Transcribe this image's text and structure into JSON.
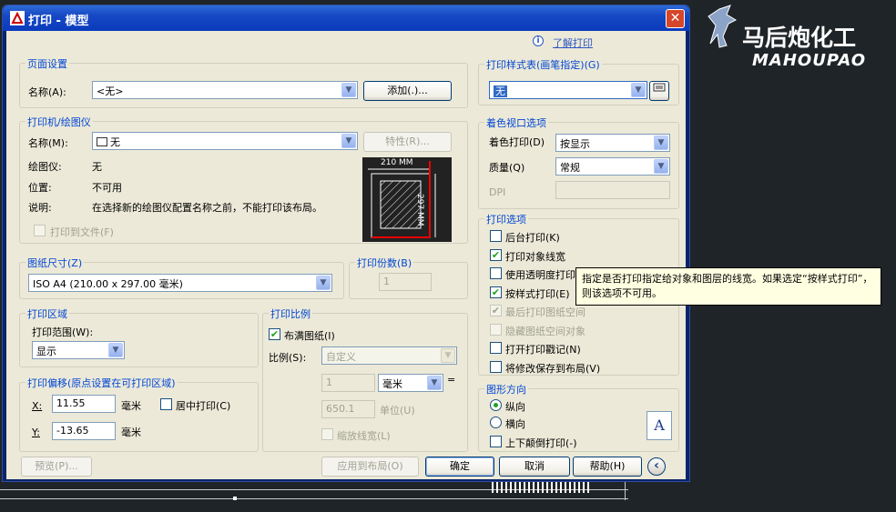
{
  "window": {
    "title": "打印 - 模型",
    "close_glyph": "✕"
  },
  "help": {
    "icon": "i",
    "link": "了解打印"
  },
  "page_setup": {
    "group": "页面设置",
    "name_label": "名称(A):",
    "name_value": "<无>",
    "add_button": "添加(.)..."
  },
  "printer": {
    "group": "打印机/绘图仪",
    "name_label": "名称(M):",
    "name_value": "无",
    "properties_button": "特性(R)...",
    "plotter_label": "绘图仪:",
    "plotter_value": "无",
    "location_label": "位置:",
    "location_value": "不可用",
    "desc_label": "说明:",
    "desc_value": "在选择新的绘图仪配置名称之前，不能打印该布局。",
    "print_to_file": "打印到文件(F)",
    "preview_width": "210 MM",
    "preview_height": "297 MM"
  },
  "paper": {
    "group": "图纸尺寸(Z)",
    "value": "ISO A4 (210.00 x 297.00 毫米)"
  },
  "copies": {
    "group": "打印份数(B)",
    "value": "1"
  },
  "area": {
    "group": "打印区域",
    "range_label": "打印范围(W):",
    "range_value": "显示"
  },
  "offset": {
    "group": "打印偏移(原点设置在可打印区域)",
    "x_label": "X:",
    "x_value": "11.55",
    "y_label": "Y:",
    "y_value": "-13.65",
    "unit": "毫米",
    "center": "居中打印(C)"
  },
  "scale": {
    "group": "打印比例",
    "fit": "布满图纸(I)",
    "scale_label": "比例(S):",
    "scale_value": "自定义",
    "v1": "1",
    "unit1": "毫米",
    "eq": "=",
    "v2": "650.1",
    "unit2": "单位(U)",
    "lineweights": "缩放线宽(L)"
  },
  "style_table": {
    "group": "打印样式表(画笔指定)(G)",
    "value": "无"
  },
  "shaded": {
    "group": "着色视口选项",
    "shade_label": "着色打印(D)",
    "shade_value": "按显示",
    "quality_label": "质量(Q)",
    "quality_value": "常规",
    "dpi_label": "DPI"
  },
  "options": {
    "group": "打印选项",
    "items": [
      {
        "label": "后台打印(K)",
        "checked": false,
        "enabled": true
      },
      {
        "label": "打印对象线宽",
        "checked": true,
        "enabled": true
      },
      {
        "label": "使用透明度打印(T)",
        "checked": false,
        "enabled": true
      },
      {
        "label": "按样式打印(E)",
        "checked": true,
        "enabled": true
      },
      {
        "label": "最后打印图纸空间",
        "checked": true,
        "enabled": false
      },
      {
        "label": "隐藏图纸空间对象",
        "checked": false,
        "enabled": false
      },
      {
        "label": "打开打印戳记(N)",
        "checked": false,
        "enabled": true
      },
      {
        "label": "将修改保存到布局(V)",
        "checked": false,
        "enabled": true
      }
    ]
  },
  "orientation": {
    "group": "图形方向",
    "portrait": "纵向",
    "landscape": "横向",
    "upside": "上下颠倒打印(-)",
    "icon": "A"
  },
  "buttons": {
    "preview": "预览(P)...",
    "apply": "应用到布局(O)",
    "ok": "确定",
    "cancel": "取消",
    "help": "帮助(H)",
    "expand": "‹"
  },
  "tooltip": "指定是否打印指定给对象和图层的线宽。如果选定“按样式打印”，则该选项不可用。",
  "logo": {
    "cn": "马后炮化工",
    "en": "MAHOUPAO"
  }
}
